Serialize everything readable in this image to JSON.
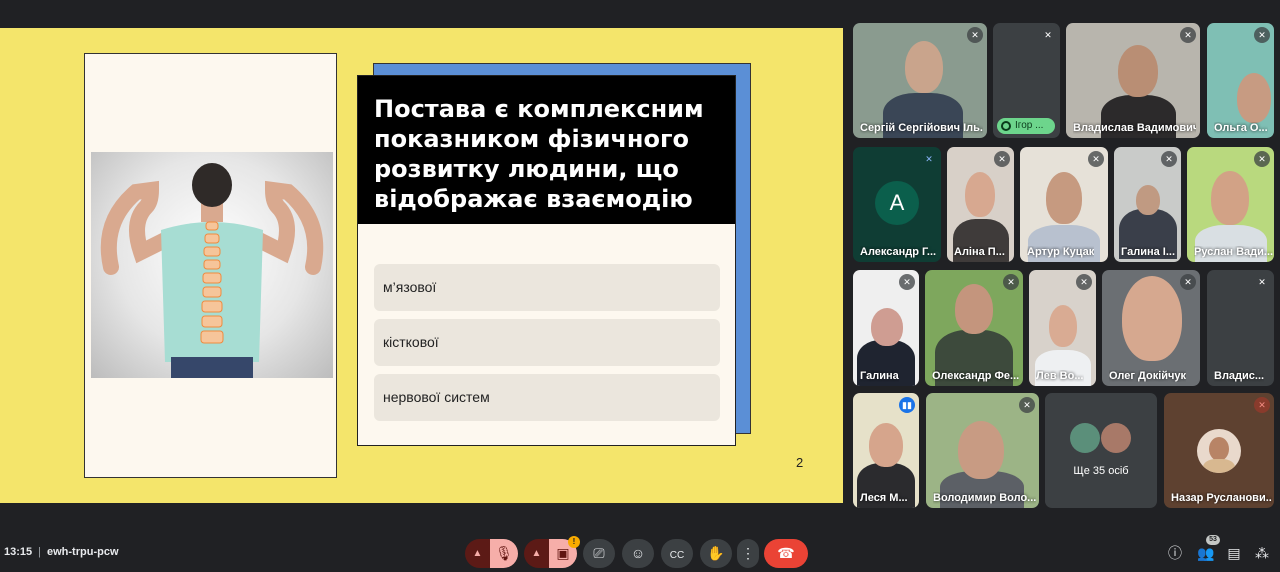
{
  "slide": {
    "question": "Постава є комплексним показником фізичного розвитку людини, що відображає взаємодію",
    "options": [
      "м’язової",
      "кісткової",
      "нервової систем"
    ],
    "page_number": "2"
  },
  "participants": [
    {
      "name": "Сергій Сергійович Іль..."
    },
    {
      "name": "Ігор ..."
    },
    {
      "name": "Владислав Вадимович"
    },
    {
      "name": "Ольга О..."
    },
    {
      "name": "Александр Г...",
      "initial": "A"
    },
    {
      "name": "Аліна П..."
    },
    {
      "name": "Артур Куцак"
    },
    {
      "name": "Галина І..."
    },
    {
      "name": "Руслан Вади..."
    },
    {
      "name": "Галина"
    },
    {
      "name": "Олександр Фе..."
    },
    {
      "name": "Лев Во..."
    },
    {
      "name": "Олег Докійчук"
    },
    {
      "name": "Владис..."
    },
    {
      "name": "Леся М..."
    },
    {
      "name": "Володимир Воло..."
    },
    {
      "name": "Ще 35 осіб"
    },
    {
      "name": "Назар Русланови..."
    }
  ],
  "bottom_bar": {
    "time": "13:15",
    "meeting_code": "ewh-trpu-pcw",
    "participant_count": "53",
    "camera_warning_badge": "!"
  },
  "icons": {
    "mic_off": "mic-off-icon",
    "cam_off": "camera-off-icon",
    "present": "present-screen-icon",
    "emoji": "emoji-icon",
    "captions": "captions-icon",
    "hand": "raise-hand-icon",
    "more": "more-vert-icon",
    "end": "end-call-icon",
    "info": "info-icon",
    "people": "people-icon",
    "chat": "chat-icon",
    "activities": "activities-icon"
  },
  "colors": {
    "slide_bg": "#f4e56b",
    "end_call": "#ea4335",
    "mic_off_bg": "#f6aea9",
    "speaking": "#6dd58c"
  }
}
